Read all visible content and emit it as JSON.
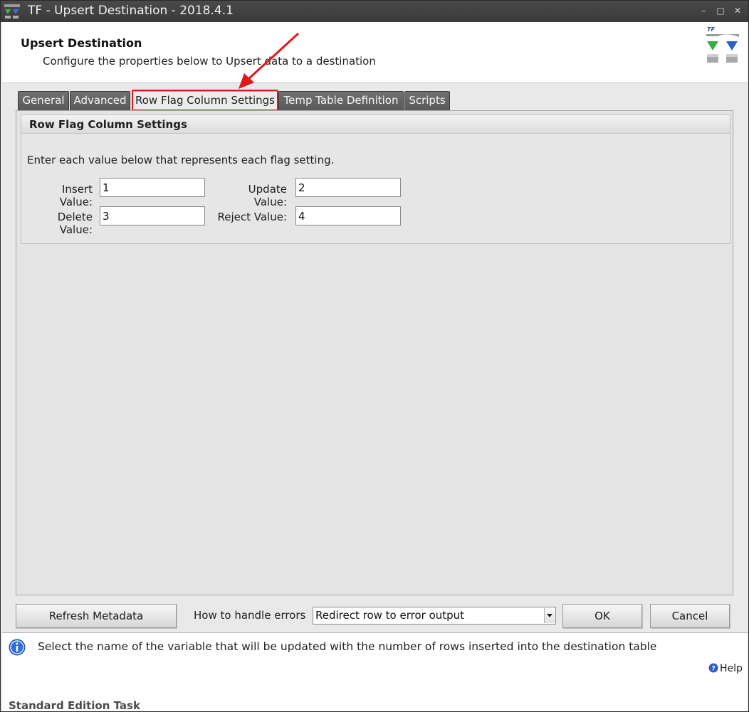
{
  "window": {
    "title": "TF - Upsert Destination - 2018.4.1",
    "minimize_icon": "minimize-icon",
    "maximize_icon": "maximize-icon",
    "close_icon": "close-icon"
  },
  "header": {
    "title": "Upsert Destination",
    "subtitle": "Configure the properties below to Upsert data to a destination",
    "logo_text": "TF"
  },
  "tabs": [
    {
      "label": "General",
      "active": false
    },
    {
      "label": "Advanced",
      "active": false
    },
    {
      "label": "Row Flag Column Settings",
      "active": true
    },
    {
      "label": "Temp Table Definition",
      "active": false
    },
    {
      "label": "Scripts",
      "active": false
    }
  ],
  "row_flag": {
    "group_title": "Row Flag Column Settings",
    "instructions": "Enter each value below that represents each flag setting.",
    "insert_label": "Insert Value:",
    "insert_value": "1",
    "update_label": "Update Value:",
    "update_value": "2",
    "delete_label": "Delete Value:",
    "delete_value": "3",
    "reject_label": "Reject Value:",
    "reject_value": "4"
  },
  "bottom": {
    "refresh_label": "Refresh Metadata",
    "errors_label": "How to handle errors",
    "errors_value": "Redirect row to error output",
    "ok_label": "OK",
    "cancel_label": "Cancel"
  },
  "info": {
    "icon": "info-icon",
    "text": "Select the name of the variable that will be updated with the number of rows inserted into the destination table",
    "help_label": "Help",
    "edition": "Standard Edition Task"
  },
  "colors": {
    "highlight": "#e0181b",
    "title_bar": "#3f3f3f",
    "tab_inactive": "#666666"
  }
}
